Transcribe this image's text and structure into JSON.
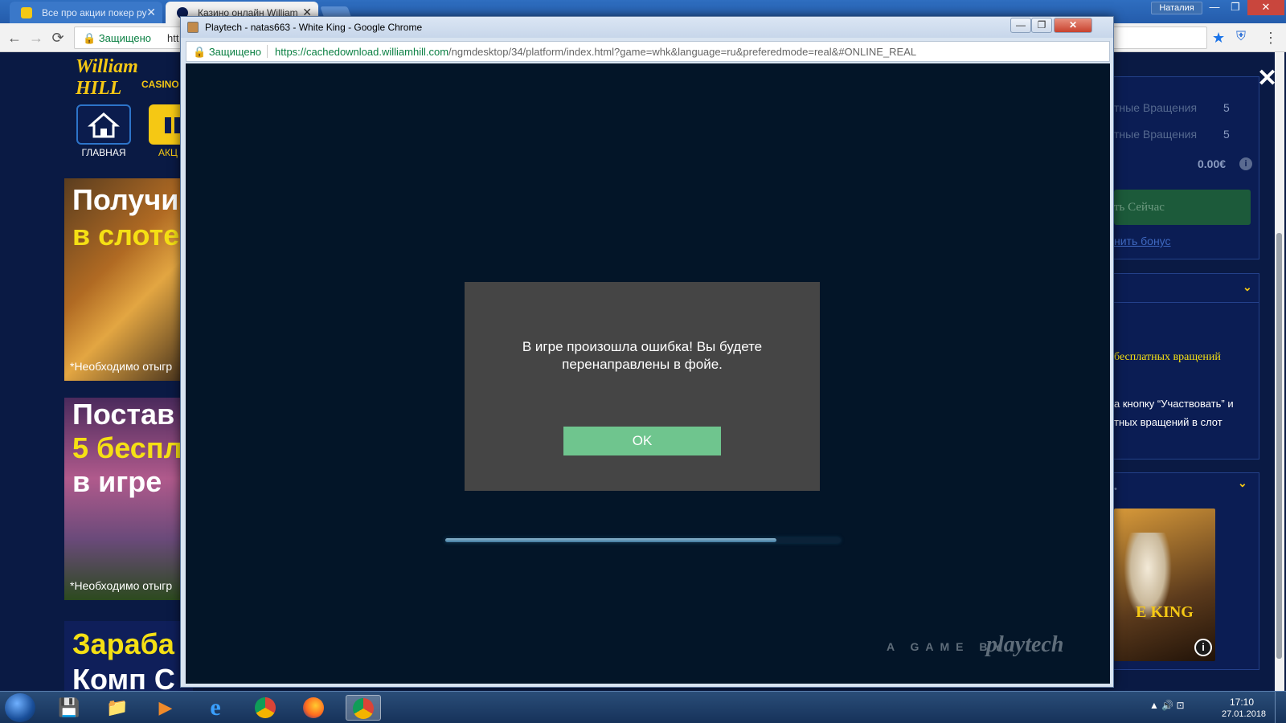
{
  "browser": {
    "tabs": [
      {
        "title": "Все про акции покер ру",
        "close": "✕"
      },
      {
        "title": "Казино онлайн William",
        "close": "✕"
      }
    ],
    "user": "Наталия",
    "secure_label": "Защищено",
    "url_visible": "htt",
    "nav": {
      "back": "←",
      "forward": "→",
      "reload": "⟳"
    },
    "star": "★",
    "menu": "⋮"
  },
  "window_controls": {
    "minimize": "—",
    "maximize": "❐",
    "close": "✕"
  },
  "casino": {
    "logo_name": "William HILL",
    "logo_sub": "CASINO",
    "nav": [
      {
        "label": "ГЛАВНАЯ",
        "icon": "home-icon"
      },
      {
        "label": "АКЦ",
        "icon": "gift-icon"
      }
    ],
    "banners": [
      {
        "line1": "Получи",
        "line2": "в слоте",
        "note": "*Необходимо отыгр"
      },
      {
        "line1": "Постав",
        "line2": "5 беспл",
        "line3": "в игре",
        "note": "*Необходимо отыгр"
      },
      {
        "line1": "Зараба",
        "line2": "Комп С"
      }
    ],
    "close_x": "✕",
    "bonus_panel": {
      "rows": [
        {
          "label": "тные Вращения",
          "value": "5"
        },
        {
          "label": "тные Вращения",
          "value": "5"
        }
      ],
      "balance": "0.00€",
      "info": "i",
      "play_button": "ть Сейчас",
      "cancel_bonus": "нить бонус"
    },
    "promo_panel": {
      "title": "бесплатных вращений",
      "text": "а кнопку “Участвовать” и тных вращений в слот"
    },
    "game_panel": {
      "dot": "•",
      "game_title": "E KING",
      "info": "i"
    }
  },
  "popup": {
    "title": "Playtech - natas663 - White King - Google Chrome",
    "secure_label": "Защищено",
    "url_host": "https://cachedownload.williamhill.com",
    "url_path": "/ngmdesktop/34/platform/index.html?game=whk&language=ru&preferedmode=real&#ONLINE_REAL",
    "dialog": {
      "message": "В игре произошла ошибка! Вы будете перенаправлены в фойе.",
      "ok_label": "OK"
    },
    "loading_progress": 0.84,
    "branding_prefix": "A GAME BY",
    "branding_logo": "playtech"
  },
  "taskbar": {
    "apps": [
      {
        "name": "floppy-icon",
        "glyph": "💾"
      },
      {
        "name": "explorer-icon",
        "glyph": "📁"
      },
      {
        "name": "media-player-icon",
        "glyph": "▶"
      },
      {
        "name": "internet-explorer-icon",
        "glyph": "e"
      },
      {
        "name": "chrome-icon",
        "glyph": ""
      },
      {
        "name": "firefox-icon",
        "glyph": ""
      },
      {
        "name": "chrome-active-icon",
        "glyph": ""
      }
    ],
    "tray": "▲  🔊  ⊡",
    "time": "17:10",
    "date": "27.01.2018"
  },
  "colors": {
    "accent_green": "#6fc58e",
    "dialog_bg": "#454545",
    "game_bg": "#031528",
    "brand_yellow": "#f5c814"
  }
}
